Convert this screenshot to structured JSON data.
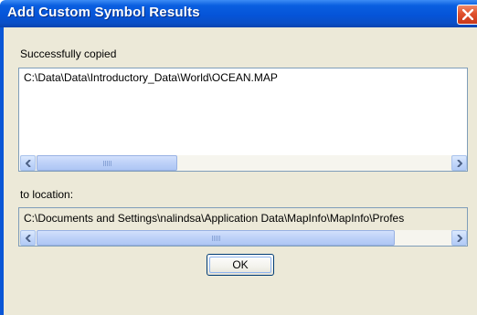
{
  "window": {
    "title": "Add Custom Symbol Results",
    "close_icon": "close-icon"
  },
  "copied_section": {
    "label": "Successfully copied",
    "items": [
      "C:\\Data\\Data\\Introductory_Data\\World\\OCEAN.MAP"
    ]
  },
  "location_section": {
    "label": "to location:",
    "value": "C:\\Documents and Settings\\nalindsa\\Application Data\\MapInfo\\MapInfo\\Profes"
  },
  "buttons": {
    "ok_label": "OK"
  },
  "colors": {
    "titlebar": "#0554d8",
    "dialog_bg": "#ece9d8",
    "close_button": "#e0502c"
  }
}
